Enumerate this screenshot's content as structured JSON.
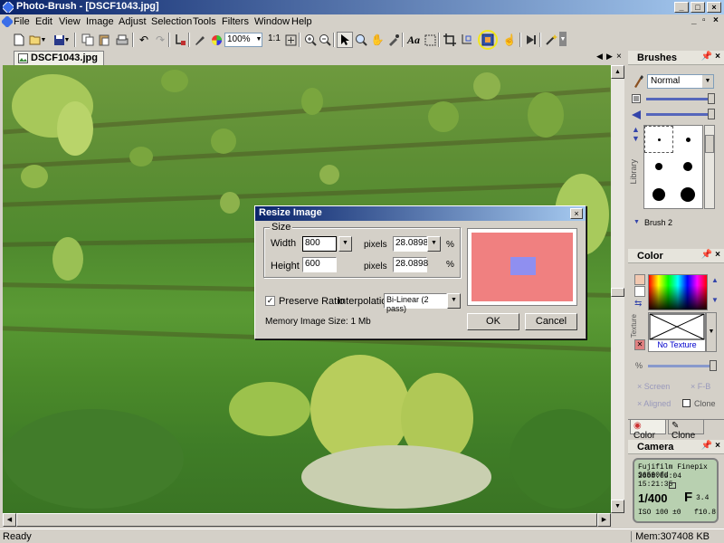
{
  "window": {
    "title": "Photo-Brush - [DSCF1043.jpg]"
  },
  "menu": {
    "items": [
      "File",
      "Edit",
      "View",
      "Image",
      "Adjust",
      "Selection",
      "Tools",
      "Filters",
      "Window",
      "Help"
    ]
  },
  "toolbar": {
    "zoom_value": "100%",
    "actual_size_label": "1:1"
  },
  "document": {
    "tab_label": "DSCF1043.jpg"
  },
  "dialog": {
    "title": "Resize Image",
    "size_group_label": "Size",
    "width_label": "Width",
    "width_value": "800",
    "height_label": "Height",
    "height_value": "600",
    "width_unit": "pixels",
    "height_unit": "pixels",
    "width_percent": "28.0898",
    "height_percent": "28.0898",
    "percent_symbol": "%",
    "preserve_ratio_label": "Preserve Ratio",
    "preserve_ratio_checked": true,
    "interpolation_label": "Interpolation:",
    "interpolation_value": "Bi-Linear (2 pass)",
    "memory_text": "Memory Image Size: 1 Mb",
    "ok_label": "OK",
    "cancel_label": "Cancel",
    "preview_bg_color": "#f08080",
    "preview_rect_color": "#8f8ff0"
  },
  "brushes_panel": {
    "title": "Brushes",
    "blend_mode": "Normal",
    "library_label": "Library",
    "current_brush": "Brush 2"
  },
  "color_panel": {
    "title": "Color",
    "texture_label": "Texture",
    "texture_value": "No Texture",
    "screen_label": "Screen",
    "fb_label": "F-B",
    "aligned_label": "Aligned",
    "clone_label": "Clone",
    "tabs": [
      "Color",
      "Clone"
    ]
  },
  "camera_panel": {
    "title": "Camera",
    "model": "Fujifilm Finepix S6500fd",
    "datetime": "2008:05:04 15:21:35",
    "shutter": "1/400",
    "aperture_label": "F",
    "aperture_value": "3.4",
    "iso": "ISO 100",
    "exposure_comp": "±0",
    "focal": "f10.8"
  },
  "status": {
    "left": "Ready",
    "memory": "Mem:307408 KB"
  },
  "icons": {
    "new": "new-file-icon",
    "open": "open-folder-icon",
    "save": "save-icon",
    "copy": "copy-icon",
    "paste": "paste-icon",
    "print": "print-icon",
    "undo": "undo-icon",
    "redo": "redo-icon"
  }
}
